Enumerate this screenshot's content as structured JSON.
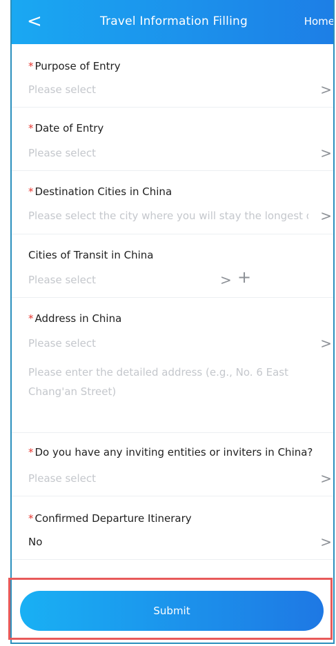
{
  "header": {
    "back_glyph": "<",
    "title": "Travel Information Filling",
    "home_label": "Home"
  },
  "fields": [
    {
      "required": true,
      "label": "Purpose of Entry",
      "value": "Please select",
      "is_placeholder": true
    },
    {
      "required": true,
      "label": "Date of Entry",
      "value": "Please select",
      "is_placeholder": true
    },
    {
      "required": true,
      "label": "Destination Cities in China",
      "value": "Please select the city where you will stay the longest dur",
      "is_placeholder": true
    },
    {
      "required": false,
      "label": "Cities of Transit in China",
      "value": "Please select",
      "is_placeholder": true
    },
    {
      "required": true,
      "label": "Address in China",
      "value": "Please select",
      "is_placeholder": true,
      "detail_placeholder": "Please enter the detailed address (e.g., No. 6 East Chang'an Street)"
    },
    {
      "required": true,
      "label": "Do you have any inviting entities or inviters in China?",
      "value": "Please select",
      "is_placeholder": true
    },
    {
      "required": true,
      "label": "Confirmed Departure Itinerary",
      "value": "No",
      "is_placeholder": false
    }
  ],
  "icons": {
    "chevron": "chevron-right-icon",
    "add": "plus-icon"
  },
  "glyphs": {
    "required_mark": "*",
    "chevron": ">",
    "plus": "+"
  },
  "submit_label": "Submit",
  "colors": {
    "header_gradient_start": "#1aa8f2",
    "header_gradient_end": "#1d7ee6",
    "required_mark": "#e6362f",
    "placeholder_text": "#c4c7cc",
    "highlight_border": "#e85a5a"
  }
}
